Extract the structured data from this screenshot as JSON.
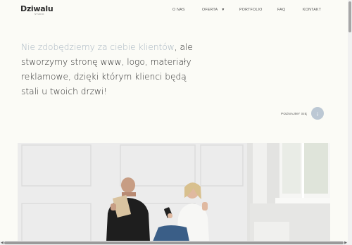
{
  "header": {
    "logo": "Dziwalu",
    "logo_sub": "STUDIO",
    "nav": [
      {
        "label": "O NAS"
      },
      {
        "label": "OFERTA"
      },
      {
        "label": "PORTFOLIO"
      },
      {
        "label": "FAQ"
      },
      {
        "label": "KONTAKT"
      }
    ]
  },
  "hero_text": {
    "accent": "Nie zdobędziemy za ciebie klientów",
    "rest": ", ale stworzymy stronę www, logo, materiały reklamowe, dzięki którym klienci będą stali u twoich drzwi!"
  },
  "cta": {
    "label": "POZNAJMY SIĘ",
    "icon": "arrow-down-icon"
  },
  "colors": {
    "background": "#fbfbf6",
    "accent_text": "#a6b4c0",
    "cta_circle": "#bcc8d4"
  }
}
